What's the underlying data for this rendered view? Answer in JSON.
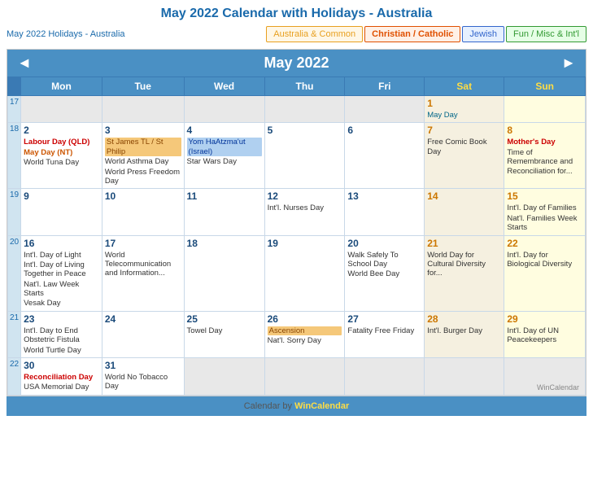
{
  "title": "May 2022 Calendar with Holidays - Australia",
  "subtitle": "May 2022 Holidays - Australia",
  "filter_tabs": [
    {
      "label": "Australia & Common",
      "class": "australia"
    },
    {
      "label": "Christian / Catholic",
      "class": "christian"
    },
    {
      "label": "Jewish",
      "class": "jewish"
    },
    {
      "label": "Fun / Misc & Int'l",
      "class": "fun"
    }
  ],
  "month_title": "May 2022",
  "nav_prev": "◄",
  "nav_next": "►",
  "weekdays": [
    "Mon",
    "Tue",
    "Wed",
    "Thu",
    "Fri",
    "Sat",
    "Sun"
  ],
  "footer": "Calendar by WinCalendar",
  "footer_link": "WinCalendar",
  "wincalendar_text": "WinCalendar"
}
